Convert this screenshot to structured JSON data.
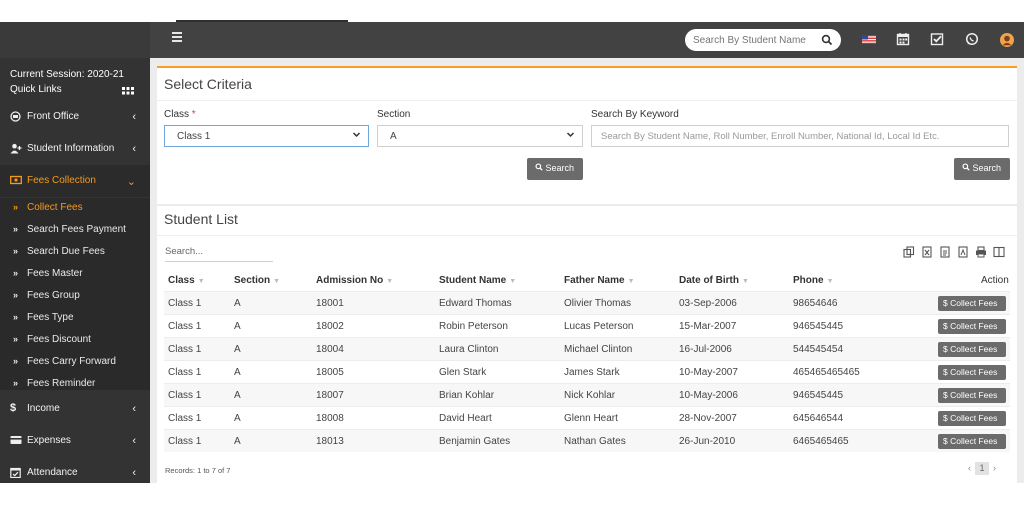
{
  "header": {
    "search_placeholder": "Search By Student Name"
  },
  "sidebar": {
    "session": "Current Session: 2020-21",
    "quick_links": "Quick Links",
    "menu": [
      {
        "label": "Front Office",
        "icon": "front-office-icon"
      },
      {
        "label": "Student Information",
        "icon": "user-plus-icon"
      },
      {
        "label": "Fees Collection",
        "icon": "money-icon",
        "active": true
      },
      {
        "label": "Income",
        "icon": "dollar-icon"
      },
      {
        "label": "Expenses",
        "icon": "credit-card-icon"
      },
      {
        "label": "Attendance",
        "icon": "calendar-check-icon"
      }
    ],
    "submenu": [
      {
        "label": "Collect Fees",
        "active": true
      },
      {
        "label": "Search Fees Payment"
      },
      {
        "label": "Search Due Fees"
      },
      {
        "label": "Fees Master"
      },
      {
        "label": "Fees Group"
      },
      {
        "label": "Fees Type"
      },
      {
        "label": "Fees Discount"
      },
      {
        "label": "Fees Carry Forward"
      },
      {
        "label": "Fees Reminder"
      }
    ]
  },
  "criteria": {
    "title": "Select Criteria",
    "class_label": "Class",
    "required_mark": "*",
    "class_value": "Class 1",
    "section_label": "Section",
    "section_value": "A",
    "keyword_label": "Search By Keyword",
    "keyword_placeholder": "Search By Student Name, Roll Number, Enroll Number, National Id, Local Id Etc.",
    "search_button": "Search"
  },
  "student_list": {
    "title": "Student List",
    "search_placeholder": "Search...",
    "columns": [
      "Class",
      "Section",
      "Admission No",
      "Student Name",
      "Father Name",
      "Date of Birth",
      "Phone",
      "Action"
    ],
    "rows": [
      [
        "Class 1",
        "A",
        "18001",
        "Edward Thomas",
        "Olivier Thomas",
        "03-Sep-2006",
        "98654646"
      ],
      [
        "Class 1",
        "A",
        "18002",
        "Robin Peterson",
        "Lucas Peterson",
        "15-Mar-2007",
        "946545445"
      ],
      [
        "Class 1",
        "A",
        "18004",
        "Laura Clinton",
        "Michael Clinton",
        "16-Jul-2006",
        "544545454"
      ],
      [
        "Class 1",
        "A",
        "18005",
        "Glen Stark",
        "James Stark",
        "10-May-2007",
        "465465465465"
      ],
      [
        "Class 1",
        "A",
        "18007",
        "Brian Kohlar",
        "Nick Kohlar",
        "10-May-2006",
        "946545445"
      ],
      [
        "Class 1",
        "A",
        "18008",
        "David Heart",
        "Glenn Heart",
        "28-Nov-2007",
        "645646544"
      ],
      [
        "Class 1",
        "A",
        "18013",
        "Benjamin Gates",
        "Nathan Gates",
        "26-Jun-2010",
        "6465465465"
      ]
    ],
    "collect_fees_label": "$ Collect Fees",
    "records_text": "Records: 1 to 7 of 7",
    "page": "1"
  },
  "colors": {
    "accent": "#f79a1a",
    "header": "#424242",
    "sidebar": "#333333",
    "button": "#6b6b6b"
  }
}
